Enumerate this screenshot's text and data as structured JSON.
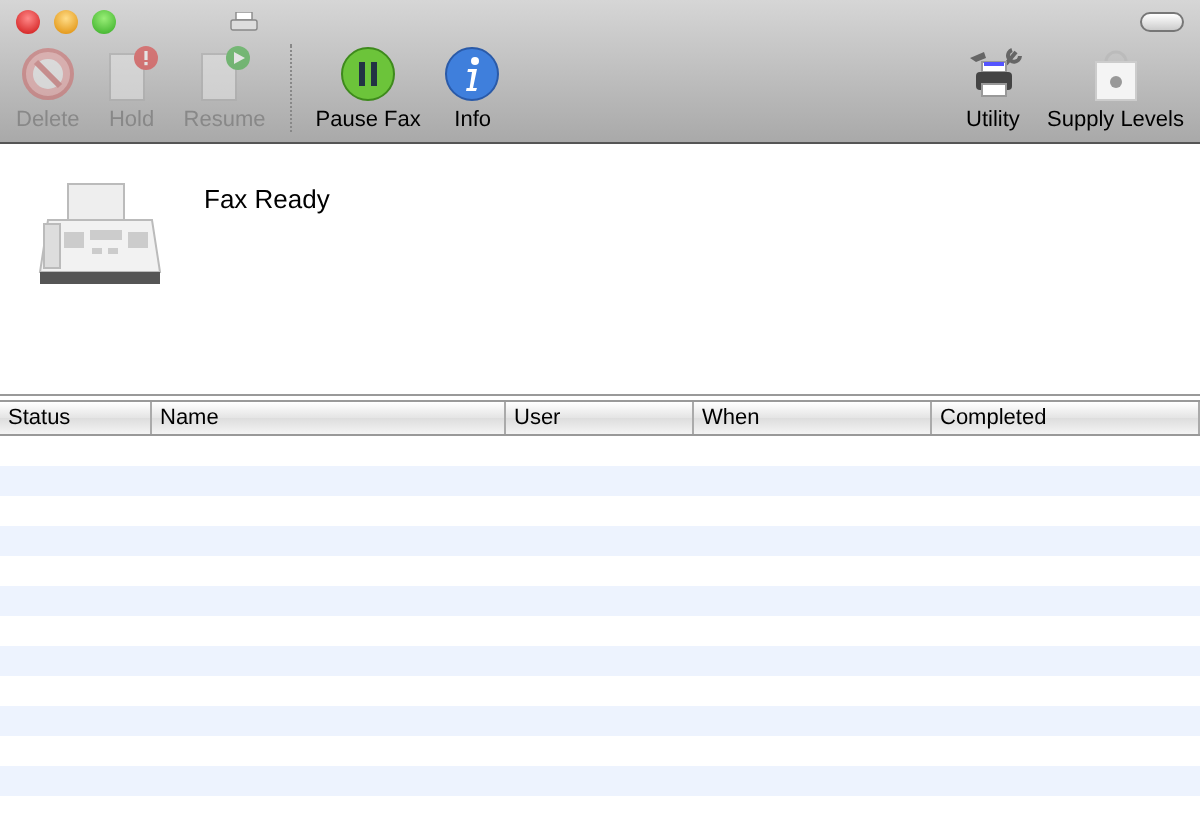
{
  "toolbar": {
    "left": [
      {
        "kind": "delete",
        "label": "Delete",
        "disabled": true
      },
      {
        "kind": "hold",
        "label": "Hold",
        "disabled": true
      },
      {
        "kind": "resume",
        "label": "Resume",
        "disabled": true
      }
    ],
    "middle": [
      {
        "kind": "pause",
        "label": "Pause Fax",
        "disabled": false
      },
      {
        "kind": "info",
        "label": "Info",
        "disabled": false
      }
    ],
    "right": [
      {
        "kind": "utility",
        "label": "Utility",
        "disabled": false
      },
      {
        "kind": "supply",
        "label": "Supply Levels",
        "disabled": false
      }
    ]
  },
  "status": {
    "message": "Fax Ready"
  },
  "table": {
    "columns": [
      "Status",
      "Name",
      "User",
      "When",
      "Completed"
    ]
  }
}
